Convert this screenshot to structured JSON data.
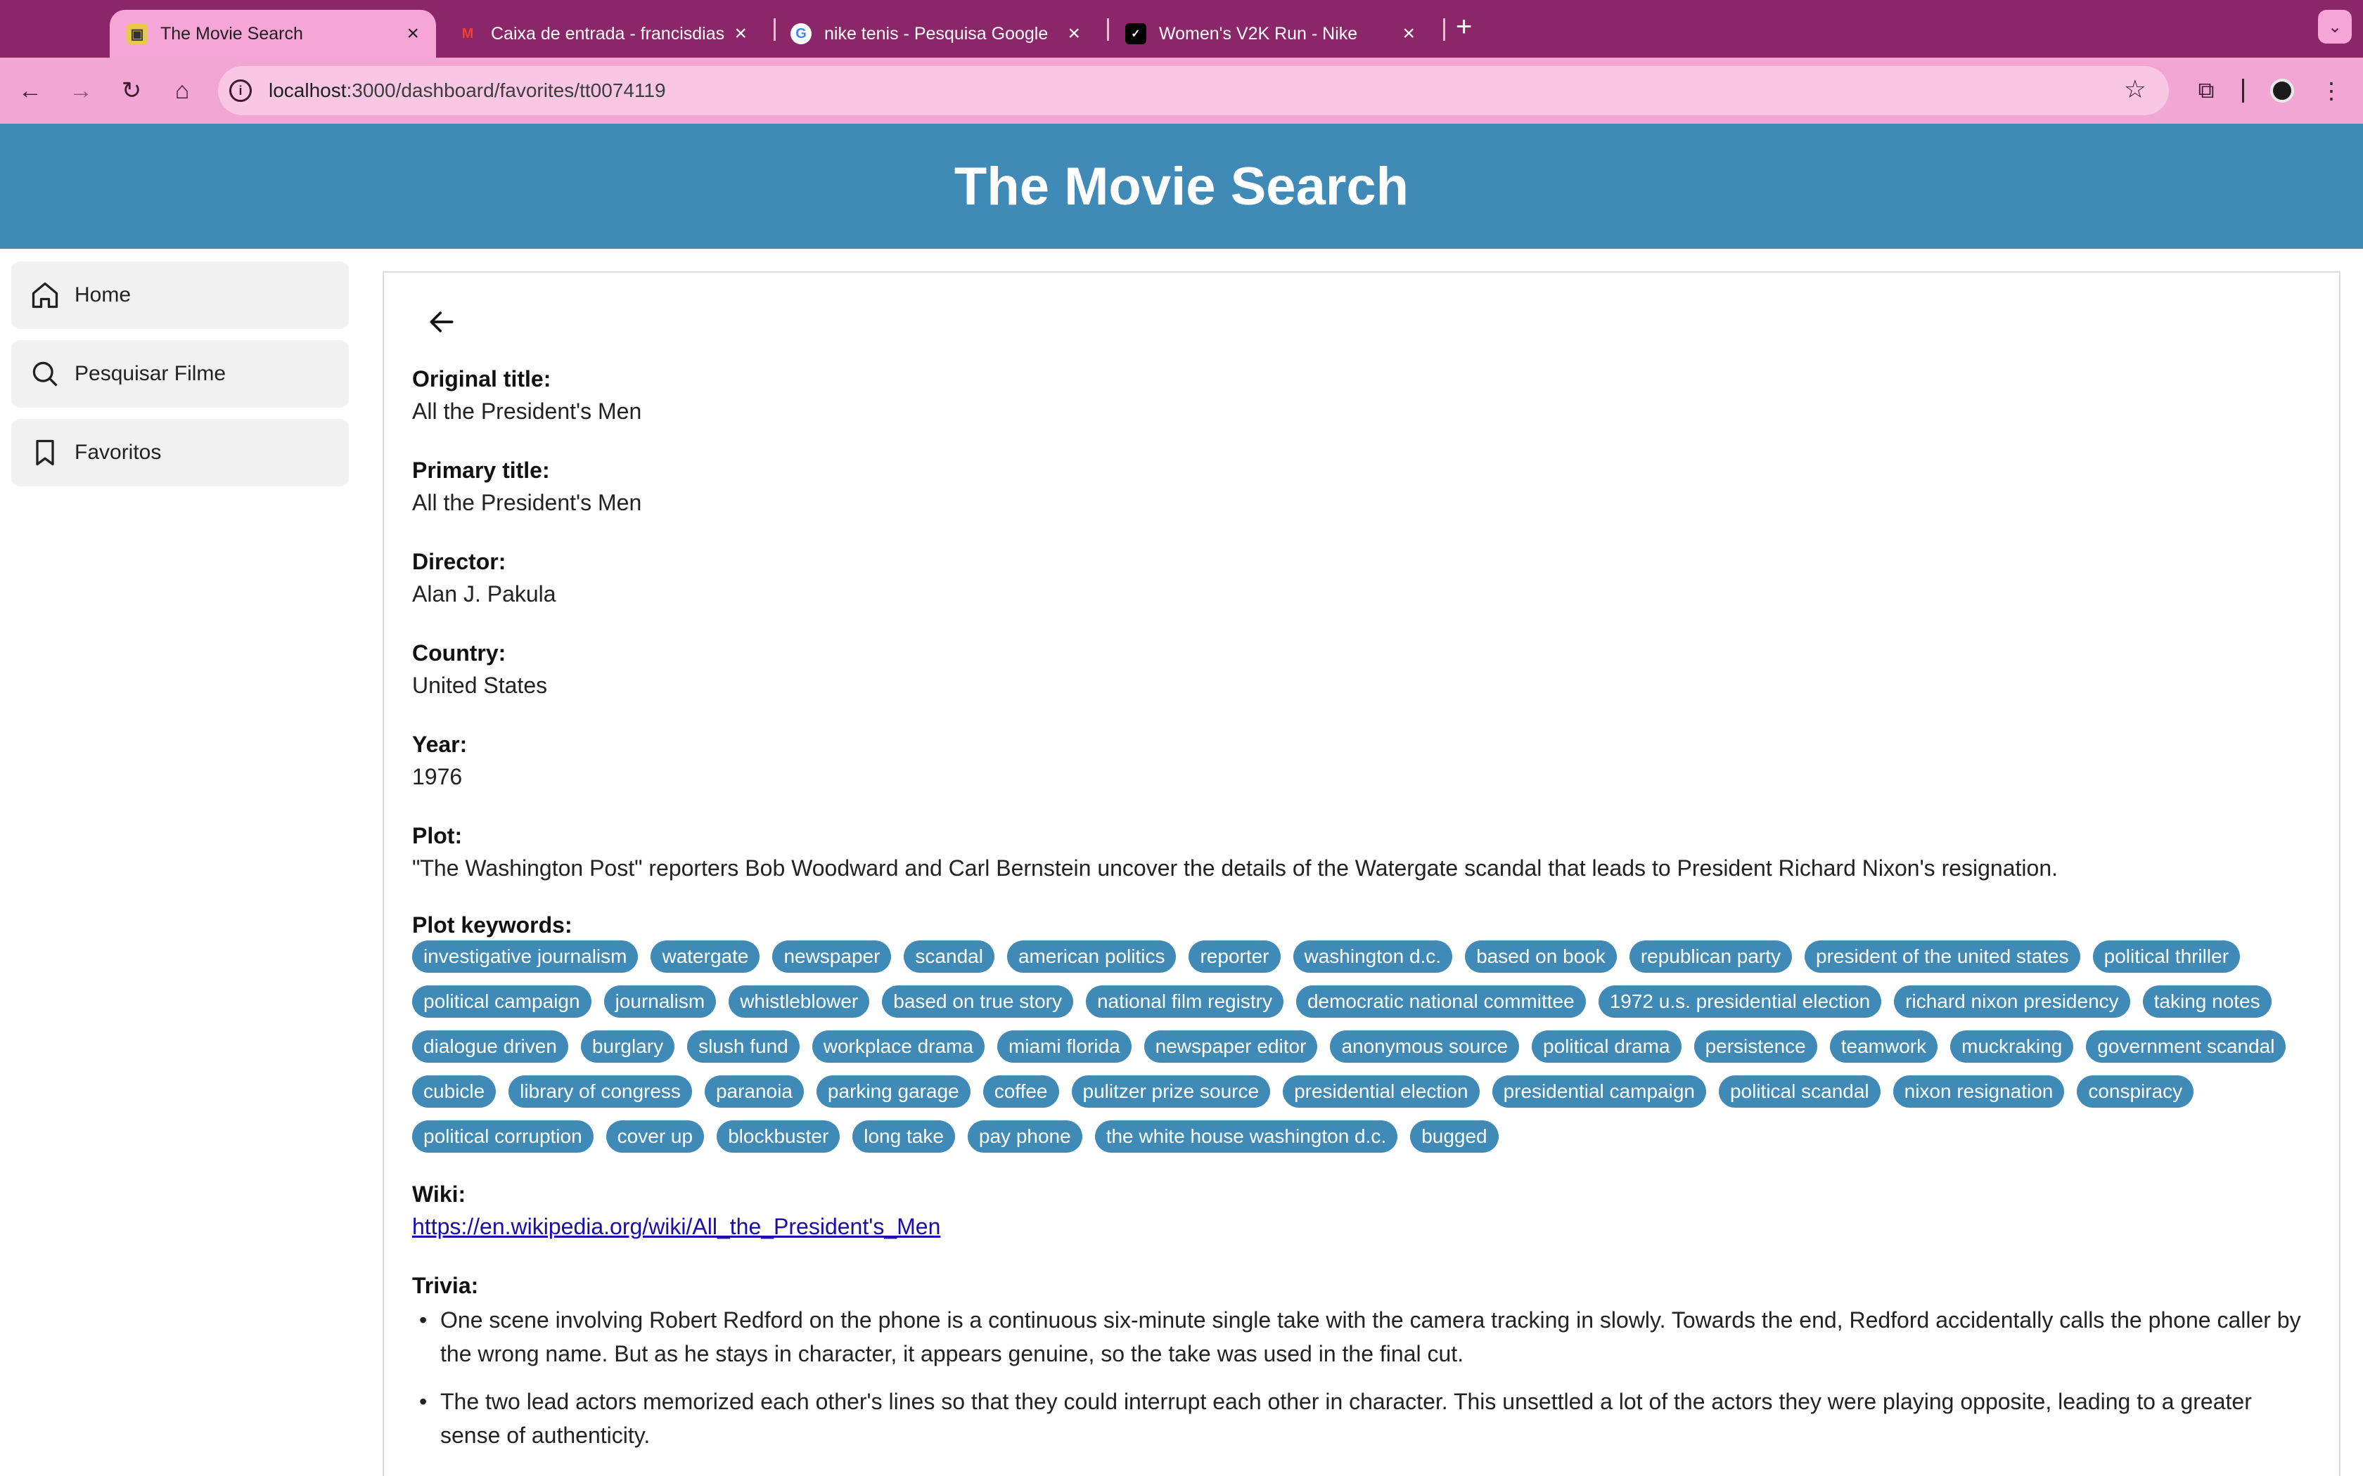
{
  "browser": {
    "tabs": [
      {
        "title": "The Movie Search",
        "active": true,
        "icon": "movie-favicon"
      },
      {
        "title": "Caixa de entrada - francisdias",
        "active": false,
        "icon": "gmail-favicon"
      },
      {
        "title": "nike tenis - Pesquisa Google",
        "active": false,
        "icon": "google-favicon"
      },
      {
        "title": "Women's V2K Run - Nike",
        "active": false,
        "icon": "nike-favicon"
      }
    ],
    "url_host": "localhost",
    "url_path": ":3000/dashboard/favorites/tt0074119"
  },
  "app": {
    "title": "The Movie Search"
  },
  "sidebar": {
    "items": [
      {
        "label": "Home",
        "icon": "home-icon"
      },
      {
        "label": "Pesquisar Filme",
        "icon": "search-icon"
      },
      {
        "label": "Favoritos",
        "icon": "bookmark-icon"
      }
    ]
  },
  "movie": {
    "original_title_label": "Original title:",
    "original_title": "All the President's Men",
    "primary_title_label": "Primary title:",
    "primary_title": "All the President's Men",
    "director_label": "Director:",
    "director": "Alan J. Pakula",
    "country_label": "Country:",
    "country": "United States",
    "year_label": "Year:",
    "year": "1976",
    "plot_label": "Plot:",
    "plot": "\"The Washington Post\" reporters Bob Woodward and Carl Bernstein uncover the details of the Watergate scandal that leads to President Richard Nixon's resignation.",
    "keywords_label": "Plot keywords:",
    "keywords": [
      "investigative journalism",
      "watergate",
      "newspaper",
      "scandal",
      "american politics",
      "reporter",
      "washington d.c.",
      "based on book",
      "republican party",
      "president of the united states",
      "political thriller",
      "political campaign",
      "journalism",
      "whistleblower",
      "based on true story",
      "national film registry",
      "democratic national committee",
      "1972 u.s. presidential election",
      "richard nixon presidency",
      "taking notes",
      "dialogue driven",
      "burglary",
      "slush fund",
      "workplace drama",
      "miami florida",
      "newspaper editor",
      "anonymous source",
      "political drama",
      "persistence",
      "teamwork",
      "muckraking",
      "government scandal",
      "cubicle",
      "library of congress",
      "paranoia",
      "parking garage",
      "coffee",
      "pulitzer prize source",
      "presidential election",
      "presidential campaign",
      "political scandal",
      "nixon resignation",
      "conspiracy",
      "political corruption",
      "cover up",
      "blockbuster",
      "long take",
      "pay phone",
      "the white house washington d.c.",
      "bugged"
    ],
    "wiki_label": "Wiki:",
    "wiki_url": "https://en.wikipedia.org/wiki/All_the_President's_Men",
    "trivia_label": "Trivia:",
    "trivia": [
      "One scene involving Robert Redford on the phone is a continuous six-minute single take with the camera tracking in slowly. Towards the end, Redford accidentally calls the phone caller by the wrong name. But as he stays in character, it appears genuine, so the take was used in the final cut.",
      "The two lead actors memorized each other's lines so that they could interrupt each other in character. This unsettled a lot of the actors they were playing opposite, leading to a greater sense of authenticity."
    ]
  },
  "colors": {
    "header": "#3f8ab6",
    "chip": "#3f8ab6",
    "tabbar": "#8b2768",
    "toolbar": "#f2a6d4"
  }
}
